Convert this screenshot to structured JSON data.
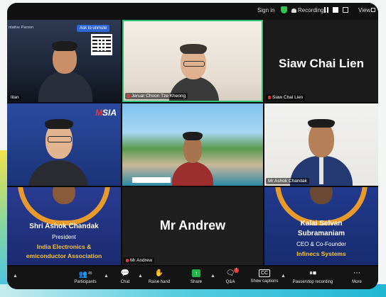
{
  "topbar": {
    "sign_in": "Sign in",
    "recording": "Recording...",
    "view": "View"
  },
  "tiles": {
    "t1": {
      "ask_button": "Ask to unmute",
      "tag": "ntative Parson",
      "name": "lilan"
    },
    "t2": {
      "name": "Jeruar Choon Tze Kheong"
    },
    "t3": {
      "big_name": "Siaw Chai Lien",
      "name": "Siaw Chai Lien"
    },
    "t4": {
      "logo_m": "M",
      "logo_rest": "SIA"
    },
    "t5": {},
    "t6": {
      "name": "Mr Ashok Chandak"
    },
    "t7": {
      "line1": "Shri Ashok Chandak",
      "line2": "President",
      "line3": "India Electronics &",
      "line4": "emiconductor Association"
    },
    "t8": {
      "big_name": "Mr Andrew",
      "name": "Mr Andrew"
    },
    "t9": {
      "line1": "Kalai Selvan",
      "line2": "Subramaniam",
      "line3": "CEO & Co-Founder",
      "line4": "Infinecs Systems"
    }
  },
  "toolbar": {
    "participants_label": "Participants",
    "participants_count": "45",
    "chat_label": "Chat",
    "raise_hand_label": "Raise hand",
    "share_label": "Share",
    "qa_label": "Q&A",
    "captions_label": "Show captions",
    "recording_label": "Pause/stop recording",
    "more_label": "More"
  },
  "colors": {
    "active_speaker": "#2fc27a",
    "share_green": "#1fb94a",
    "mic_off_red": "#e23b3b",
    "banner_orange": "#e89a2a",
    "banner_yellow": "#f5c33a"
  }
}
